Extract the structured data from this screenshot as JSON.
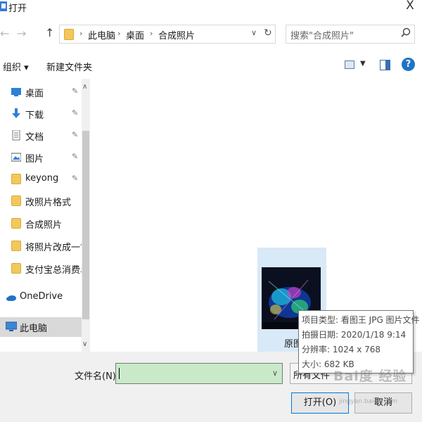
{
  "window": {
    "title": "打开",
    "close_glyph": "X"
  },
  "nav": {
    "back": "←",
    "forward": "→",
    "up": "↑",
    "breadcrumbs": [
      "此电脑",
      "桌面",
      "合成照片"
    ],
    "separator": "›",
    "dropdown_glyph": "∨",
    "refresh_glyph": "↻"
  },
  "search": {
    "placeholder": "搜索\"合成照片\"",
    "icon": "search-icon"
  },
  "toolbar": {
    "organize_label": "组织 ▾",
    "new_folder_label": "新建文件夹",
    "help_glyph": "?"
  },
  "sidebar": {
    "items": [
      {
        "label": "桌面",
        "icon": "desktop-icon",
        "pinned": true
      },
      {
        "label": "下载",
        "icon": "download-icon",
        "pinned": true
      },
      {
        "label": "文档",
        "icon": "document-icon",
        "pinned": true
      },
      {
        "label": "图片",
        "icon": "picture-icon",
        "pinned": true
      },
      {
        "label": "keyong",
        "icon": "folder-icon",
        "pinned": true
      },
      {
        "label": "改照片格式",
        "icon": "folder-icon",
        "pinned": false
      },
      {
        "label": "合成照片",
        "icon": "folder-icon",
        "pinned": false
      },
      {
        "label": "将照片改成一寸",
        "icon": "folder-icon",
        "pinned": false
      },
      {
        "label": "支付宝总消费单",
        "icon": "folder-icon",
        "pinned": false
      },
      {
        "label": "OneDrive",
        "icon": "cloud-icon",
        "pinned": false
      },
      {
        "label": "此电脑",
        "icon": "computer-icon",
        "pinned": false,
        "selected": true
      }
    ],
    "pin_glyph": "📌"
  },
  "content": {
    "file_label": "原图"
  },
  "tooltip": {
    "lines": [
      "项目类型: 看图王 JPG 图片文件",
      "拍摄日期: 2020/1/18 9:14",
      "分辨率: 1024 x 768",
      "大小: 682 KB"
    ]
  },
  "bottom": {
    "filename_label": "文件名(N):",
    "filename_value": "",
    "type_select_text": "所有文件",
    "open_label": "打开(O)",
    "cancel_label": "取消"
  },
  "watermark": {
    "text": "Bai度 经验",
    "sub": "jingyan.baidu.com"
  }
}
